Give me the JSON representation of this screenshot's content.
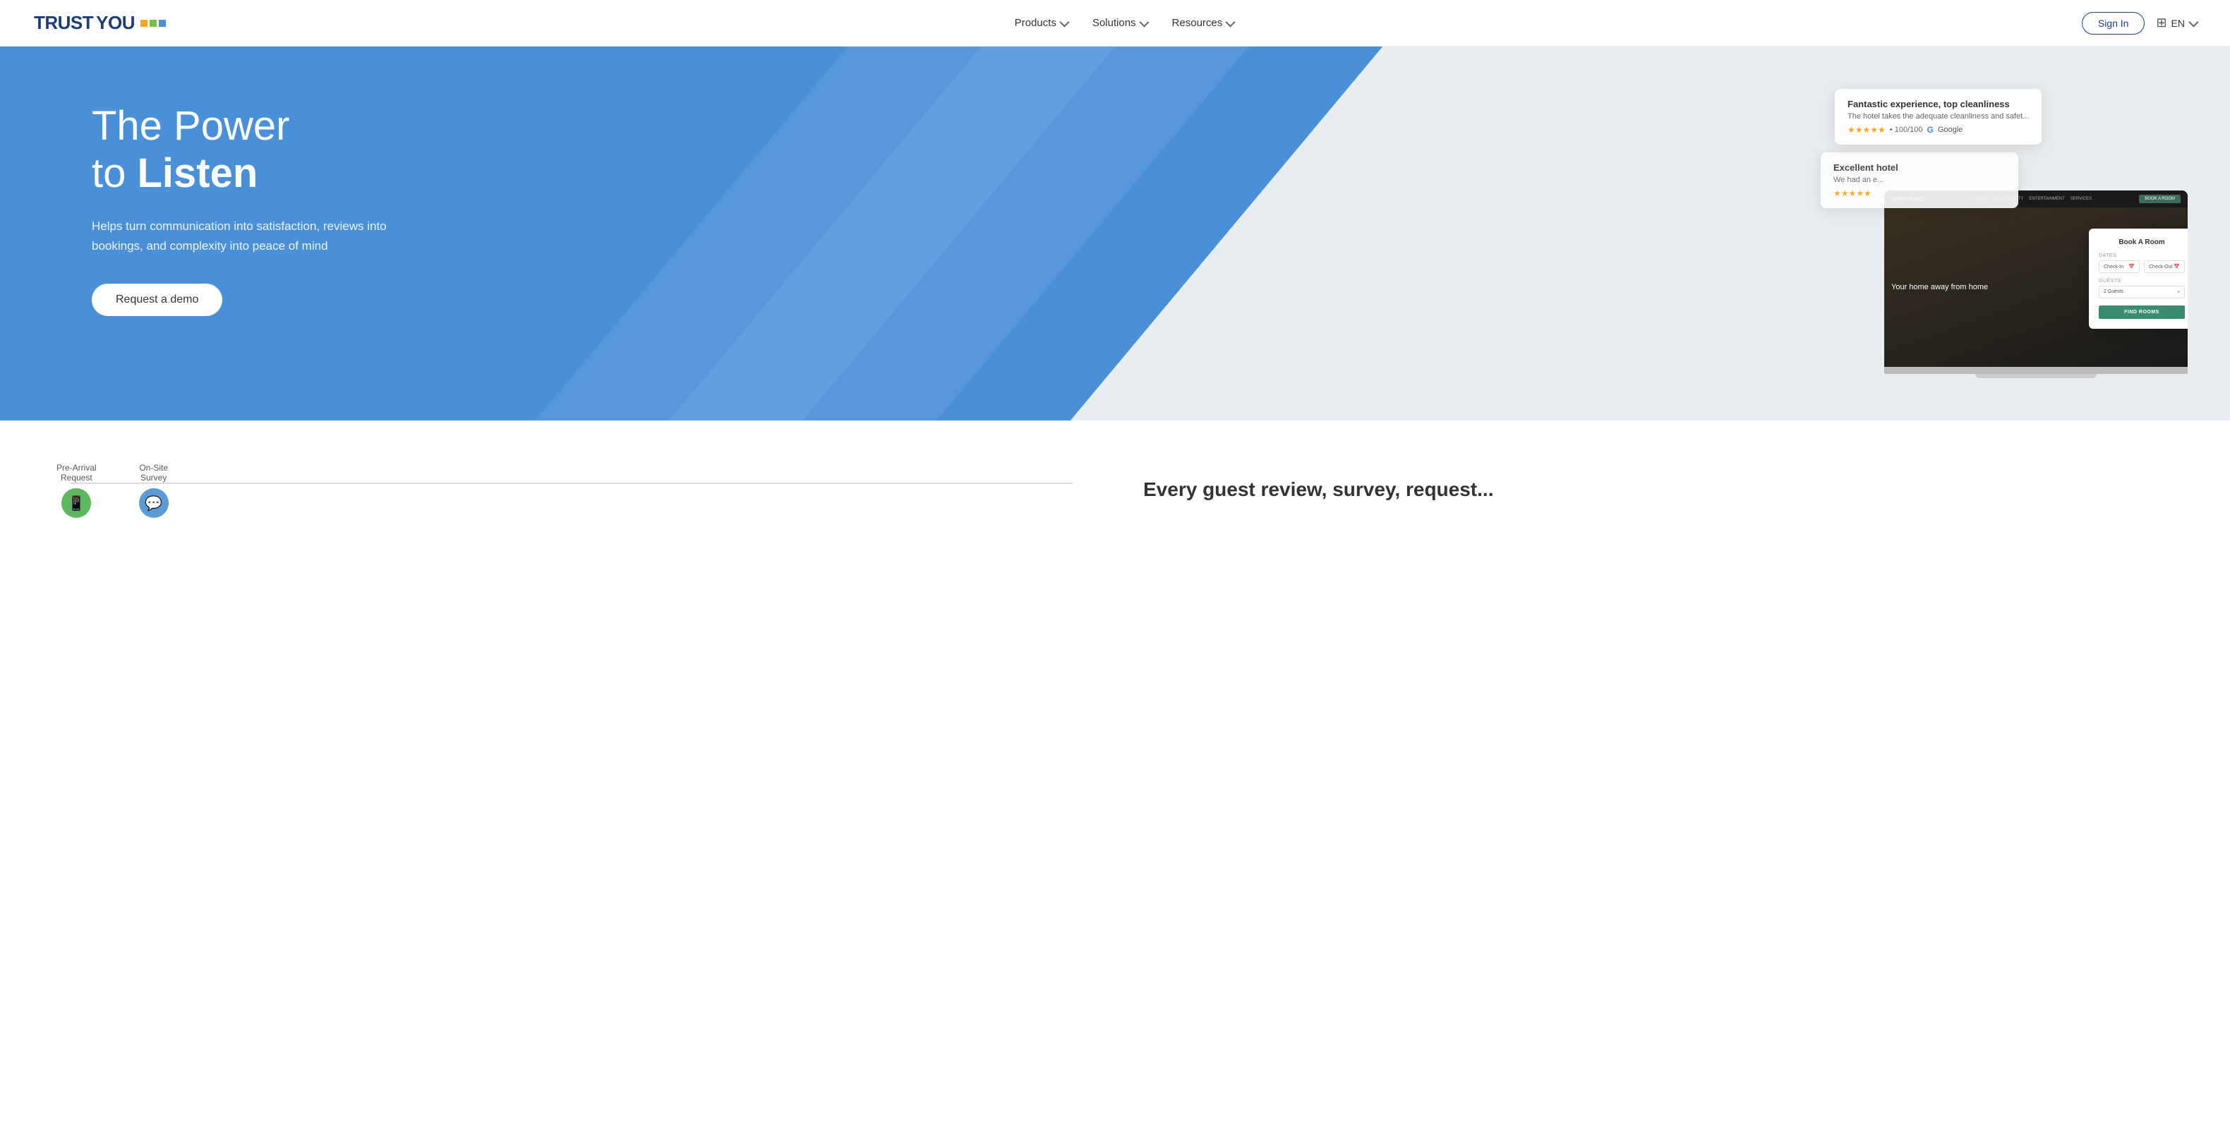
{
  "header": {
    "logo": {
      "trust": "TRUST",
      "you": "YOU"
    },
    "nav": {
      "products_label": "Products",
      "solutions_label": "Solutions",
      "resources_label": "Resources"
    },
    "sign_in_label": "Sign In",
    "lang_label": "EN"
  },
  "hero": {
    "title_line1": "The Power",
    "title_line2": "to ",
    "title_bold": "Listen",
    "subtitle": "Helps turn communication into satisfaction, reviews into bookings, and complexity into peace of mind",
    "cta_label": "Request a demo",
    "review_card_1": {
      "title": "Fantastic experience, top cleanliness",
      "text": "The hotel takes the adequate cleanliness and safet...",
      "score": "100/100",
      "stars": "★★★★★",
      "source": "Google"
    },
    "review_card_2": {
      "title": "Excellent hotel",
      "text": "We had an e...",
      "stars": "★★★★★"
    },
    "laptop": {
      "hotel_name": "SAPPHIRE",
      "nav_items": [
        "DINING",
        "SPA & BEAUTY",
        "ENTERTAINMENT",
        "SERVICES"
      ],
      "room_tagline": "Your home away from home",
      "book_panel": {
        "title": "Book A Room",
        "dates_label": "DATES",
        "checkin_label": "Check-In",
        "checkout_label": "Check-Out",
        "guests_label": "GUESTS",
        "guests_value": "2 Guests",
        "find_rooms_label": "FIND ROOMS"
      }
    }
  },
  "bottom": {
    "timeline": {
      "item1_label": "Pre-Arrival\nRequest",
      "item1_icon": "📱",
      "item2_label": "On-Site\nSurvey",
      "item2_icon": "💬"
    },
    "right_title": "Every guest review, survey, request..."
  }
}
